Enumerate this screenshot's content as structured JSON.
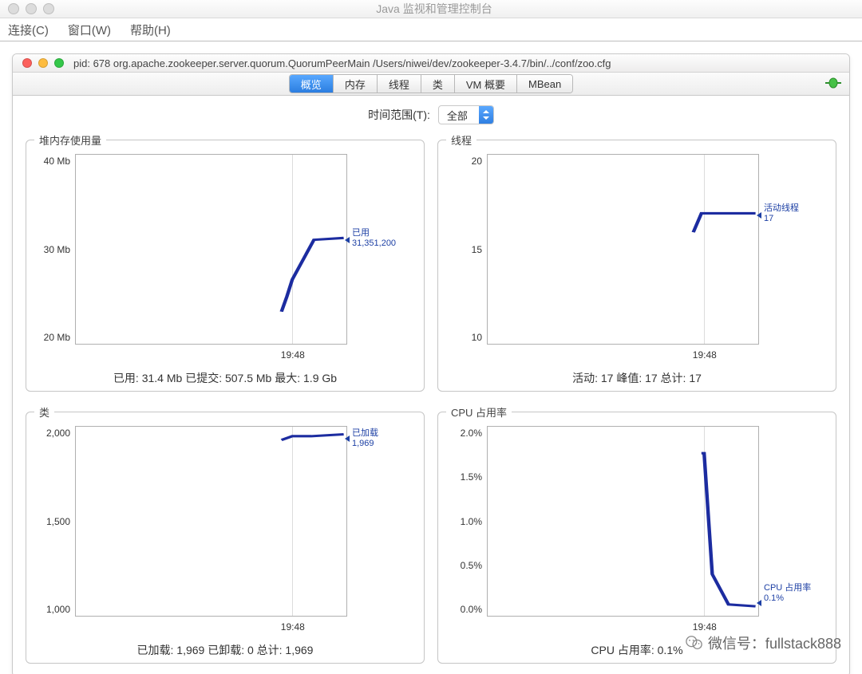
{
  "outer_title": "Java 监视和管理控制台",
  "menubar": {
    "connect": "连接(C)",
    "window": "窗口(W)",
    "help": "帮助(H)"
  },
  "process_title": "pid: 678 org.apache.zookeeper.server.quorum.QuorumPeerMain /Users/niwei/dev/zookeeper-3.4.7/bin/../conf/zoo.cfg",
  "tabs": {
    "overview": "概览",
    "memory": "内存",
    "threads": "线程",
    "classes": "类",
    "vm": "VM 概要",
    "mbean": "MBean"
  },
  "time_scope_label": "时间范围(T):",
  "time_scope_value": "全部",
  "panels": {
    "heap": {
      "title": "堆内存使用量",
      "yticks": [
        "40 Mb",
        "30 Mb",
        "20 Mb"
      ],
      "xtick": "19:48",
      "callout": [
        "已用",
        "31,351,200"
      ],
      "summary": "已用: 31.4 Mb    已提交: 507.5 Mb    最大: 1.9 Gb"
    },
    "threads": {
      "title": "线程",
      "yticks": [
        "20",
        "15",
        "10"
      ],
      "xtick": "19:48",
      "callout": [
        "活动线程",
        "17"
      ],
      "summary": "活动: 17    峰值: 17    总计: 17"
    },
    "classes": {
      "title": "类",
      "yticks": [
        "2,000",
        "1,500",
        "1,000"
      ],
      "xtick": "19:48",
      "callout": [
        "已加载",
        "1,969"
      ],
      "summary": "已加载: 1,969    已卸载: 0    总计: 1,969"
    },
    "cpu": {
      "title": "CPU 占用率",
      "yticks": [
        "2.0%",
        "1.5%",
        "1.0%",
        "0.5%",
        "0.0%"
      ],
      "xtick": "19:48",
      "callout": [
        "CPU 占用率",
        "0.1%"
      ],
      "summary": "CPU 占用率: 0.1%"
    }
  },
  "watermark": "微信号：fullstack888",
  "chart_data": [
    {
      "type": "line",
      "name": "heap",
      "title": "堆内存使用量",
      "ylabel": "Mb",
      "ylim": [
        20,
        40
      ],
      "x": [
        "19:48"
      ],
      "series": [
        {
          "name": "已用",
          "values_mb": [
            23.5,
            25.0,
            27.0,
            31.0,
            31.4
          ]
        }
      ],
      "current_used_bytes": 31351200
    },
    {
      "type": "line",
      "name": "threads",
      "title": "线程",
      "ylabel": "threads",
      "ylim": [
        10,
        20
      ],
      "x": [
        "19:48"
      ],
      "series": [
        {
          "name": "活动线程",
          "values": [
            16,
            17,
            17,
            17
          ]
        }
      ]
    },
    {
      "type": "line",
      "name": "classes",
      "title": "类",
      "ylabel": "count",
      "ylim": [
        1000,
        2000
      ],
      "x": [
        "19:48"
      ],
      "series": [
        {
          "name": "已加载",
          "values": [
            1940,
            1955,
            1960,
            1969
          ]
        }
      ]
    },
    {
      "type": "line",
      "name": "cpu",
      "title": "CPU 占用率",
      "ylabel": "%",
      "ylim": [
        0,
        2
      ],
      "x": [
        "19:48"
      ],
      "series": [
        {
          "name": "CPU 占用率",
          "values_pct": [
            1.7,
            1.7,
            0.45,
            0.12,
            0.1
          ]
        }
      ]
    }
  ]
}
